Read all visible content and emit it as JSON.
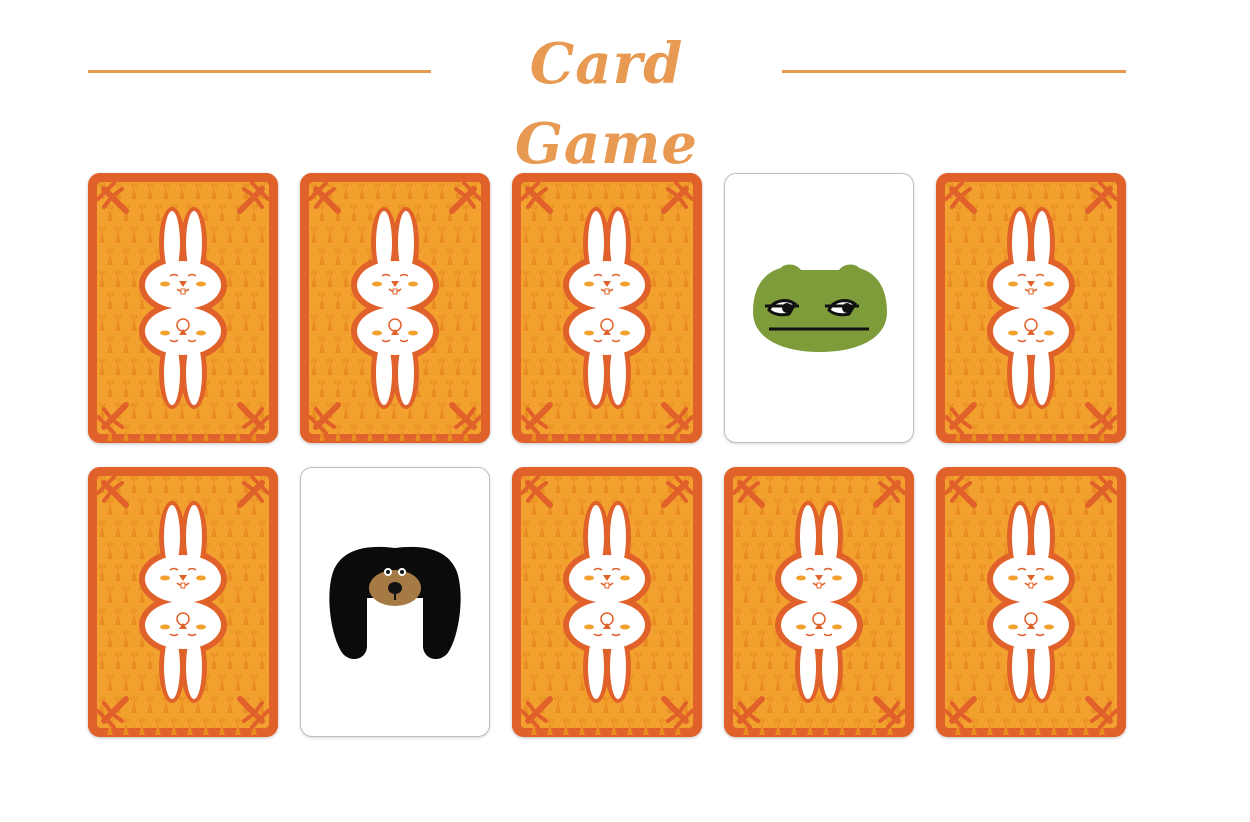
{
  "title": "Card Game",
  "colors": {
    "accent": "#e89a52",
    "card_border": "#e0612a",
    "card_pattern": "#f2a12e",
    "card_pattern_dark": "#e98d22",
    "bunny_white": "#ffffff",
    "bunny_cheek": "#f2a12e",
    "frog_green": "#7f9c3a",
    "dog_black": "#0b0b0b",
    "dog_muzzle": "#a57a45",
    "face_up_bg": "#ffffff"
  },
  "board": {
    "rows": 2,
    "columns": 5,
    "cards": [
      {
        "state": "face-down",
        "back": "bunny-card-back"
      },
      {
        "state": "face-down",
        "back": "bunny-card-back"
      },
      {
        "state": "face-down",
        "back": "bunny-card-back"
      },
      {
        "state": "face-up",
        "face": "frog"
      },
      {
        "state": "face-down",
        "back": "bunny-card-back"
      },
      {
        "state": "face-down",
        "back": "bunny-card-back"
      },
      {
        "state": "face-up",
        "face": "dog"
      },
      {
        "state": "face-down",
        "back": "bunny-card-back"
      },
      {
        "state": "face-down",
        "back": "bunny-card-back"
      },
      {
        "state": "face-down",
        "back": "bunny-card-back"
      }
    ]
  }
}
